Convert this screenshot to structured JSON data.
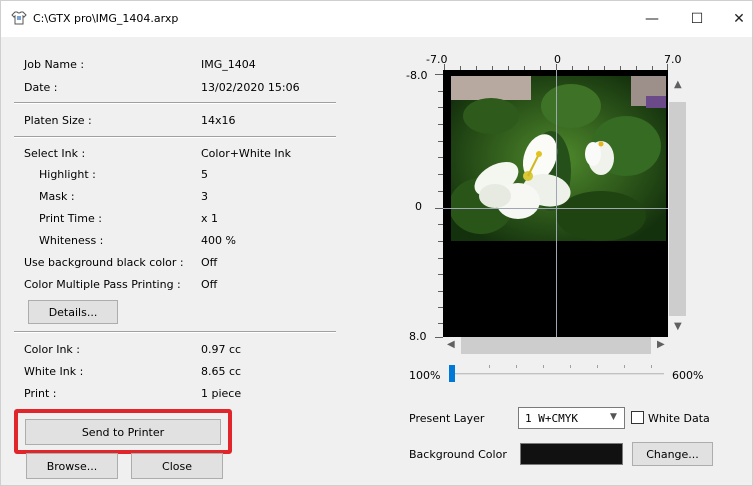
{
  "window": {
    "title": "C:\\GTX pro\\IMG_1404.arxp",
    "minimize_glyph": "—",
    "maximize_glyph": "☐",
    "close_glyph": "✕"
  },
  "info": {
    "job_name_label": "Job Name :",
    "job_name_value": "IMG_1404",
    "date_label": "Date :",
    "date_value": "13/02/2020 15:06",
    "platen_size_label": "Platen Size :",
    "platen_size_value": "14x16",
    "select_ink_label": "Select Ink :",
    "select_ink_value": "Color+White Ink",
    "highlight_label": "Highlight :",
    "highlight_value": "5",
    "mask_label": "Mask :",
    "mask_value": "3",
    "print_time_label": "Print Time :",
    "print_time_value": "x 1",
    "whiteness_label": "Whiteness :",
    "whiteness_value": "400 %",
    "bg_black_label": "Use background black color :",
    "bg_black_value": "Off",
    "multipass_label": "Color Multiple Pass Printing :",
    "multipass_value": "Off",
    "details_button": "Details...",
    "color_ink_label": "Color Ink :",
    "color_ink_value": "0.97 cc",
    "white_ink_label": "White Ink :",
    "white_ink_value": "8.65 cc",
    "print_label": "Print :",
    "print_value": "1 piece"
  },
  "actions": {
    "send_to_printer": "Send to Printer",
    "browse": "Browse...",
    "close": "Close"
  },
  "preview": {
    "ruler_x_min": "-7.0",
    "ruler_x_mid": "0",
    "ruler_x_max": "7.0",
    "ruler_y_min": "-8.0",
    "ruler_y_mid": "0",
    "ruler_y_max": "8.0",
    "zoom_min": "100%",
    "zoom_max": "600%",
    "zoom_level": 0
  },
  "layer": {
    "present_layer_label": "Present Layer",
    "present_layer_value": "1  W+CMYK",
    "white_data_label": "White Data",
    "white_data_checked": false,
    "background_color_label": "Background Color",
    "background_color_value": "#111111",
    "change_button": "Change..."
  }
}
